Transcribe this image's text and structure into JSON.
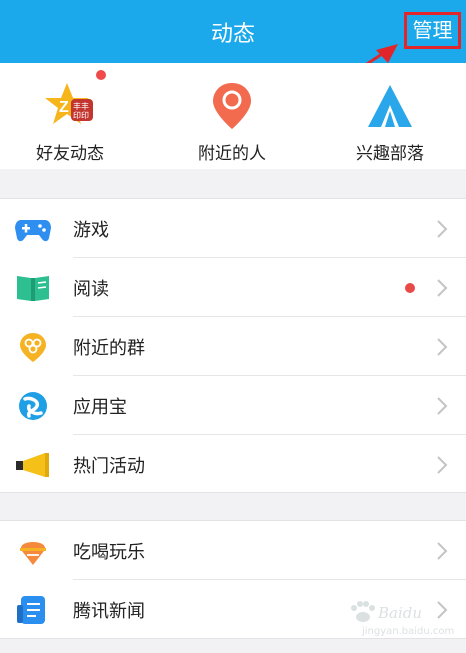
{
  "header": {
    "title": "动态",
    "manage_label": "管理"
  },
  "quick_items": [
    {
      "label": "好友动态",
      "icon": "friend-feed-icon"
    },
    {
      "label": "附近的人",
      "icon": "location-pin-icon"
    },
    {
      "label": "兴趣部落",
      "icon": "tent-icon"
    }
  ],
  "group1": [
    {
      "label": "游戏",
      "icon": "gamepad-icon",
      "color": "#2f8ff0"
    },
    {
      "label": "阅读",
      "icon": "book-icon",
      "color": "#2dbf8f",
      "has_dot": true
    },
    {
      "label": "附近的群",
      "icon": "nearby-group-icon",
      "color": "#f5b324"
    },
    {
      "label": "应用宝",
      "icon": "app-store-icon",
      "color": "#1f9fe6"
    },
    {
      "label": "热门活动",
      "icon": "megaphone-icon",
      "color": "#f5c118"
    }
  ],
  "group2": [
    {
      "label": "吃喝玩乐",
      "icon": "food-icon",
      "color": "#f58a3c"
    },
    {
      "label": "腾讯新闻",
      "icon": "news-icon",
      "color": "#2b8ff0"
    }
  ],
  "watermark": {
    "text": "Baidu",
    "sub": "jingyan.baidu.com"
  },
  "colors": {
    "header_bg": "#1ba9ec",
    "highlight": "#e0262b",
    "dot": "#f04a4a"
  }
}
